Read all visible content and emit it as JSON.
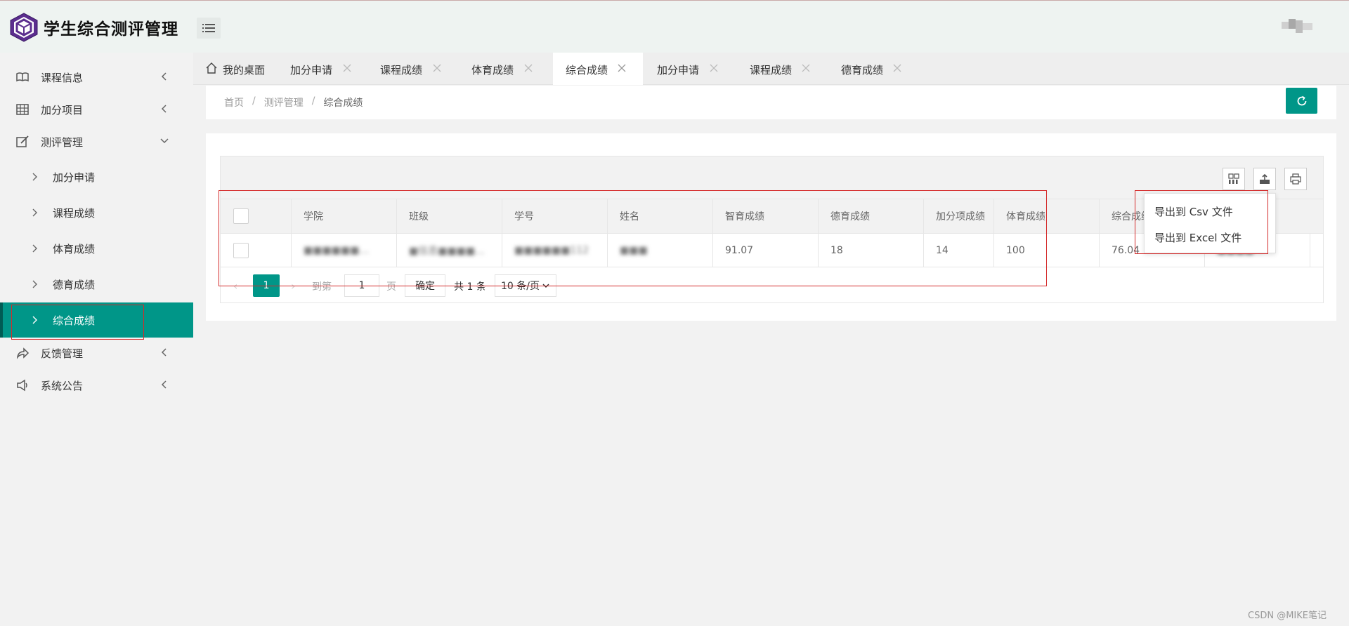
{
  "app": {
    "title": "学生综合测评管理"
  },
  "sidebar": {
    "items": [
      {
        "label": "课程信息",
        "icon": "book-icon",
        "expanded": false
      },
      {
        "label": "加分项目",
        "icon": "grid-icon",
        "expanded": false
      },
      {
        "label": "测评管理",
        "icon": "edit-icon",
        "expanded": true
      },
      {
        "label": "反馈管理",
        "icon": "share-icon",
        "expanded": false
      },
      {
        "label": "系统公告",
        "icon": "megaphone-icon",
        "expanded": false
      }
    ],
    "subitems": [
      {
        "label": "加分申请"
      },
      {
        "label": "课程成绩"
      },
      {
        "label": "体育成绩"
      },
      {
        "label": "德育成绩"
      },
      {
        "label": "综合成绩",
        "active": true
      }
    ]
  },
  "tabs": [
    {
      "label": "我的桌面",
      "icon": "home-icon"
    },
    {
      "label": "加分申请"
    },
    {
      "label": "课程成绩"
    },
    {
      "label": "体育成绩"
    },
    {
      "label": "综合成绩",
      "active": true
    },
    {
      "label": "加分申请"
    },
    {
      "label": "课程成绩"
    },
    {
      "label": "德育成绩"
    }
  ],
  "breadcrumb": {
    "home": "首页",
    "section": "测评管理",
    "current": "综合成绩"
  },
  "table": {
    "columns": [
      "学院",
      "班级",
      "学号",
      "姓名",
      "智育成绩",
      "德育成绩",
      "加分项成绩",
      "体育成绩",
      "综合成绩"
    ],
    "rows": [
      {
        "college": "■■■■■■…",
        "class": "■信息■■■■…",
        "student_id": "■■■■■■112",
        "name": "■■■",
        "intellectual": "91.07",
        "moral": "18",
        "bonus": "14",
        "sports": "100",
        "total": "76.04",
        "extra": "■■■■…"
      }
    ]
  },
  "pagination": {
    "current": "1",
    "goto_label": "到第",
    "page_input": "1",
    "page_label": "页",
    "confirm": "确定",
    "total": "共 1 条",
    "page_size": "10 条/页"
  },
  "export_menu": {
    "csv": "导出到 Csv 文件",
    "excel": "导出到 Excel 文件"
  },
  "watermark": "CSDN @MIKE笔记",
  "colors": {
    "primary": "#009688",
    "highlight": "#d42b2b"
  }
}
